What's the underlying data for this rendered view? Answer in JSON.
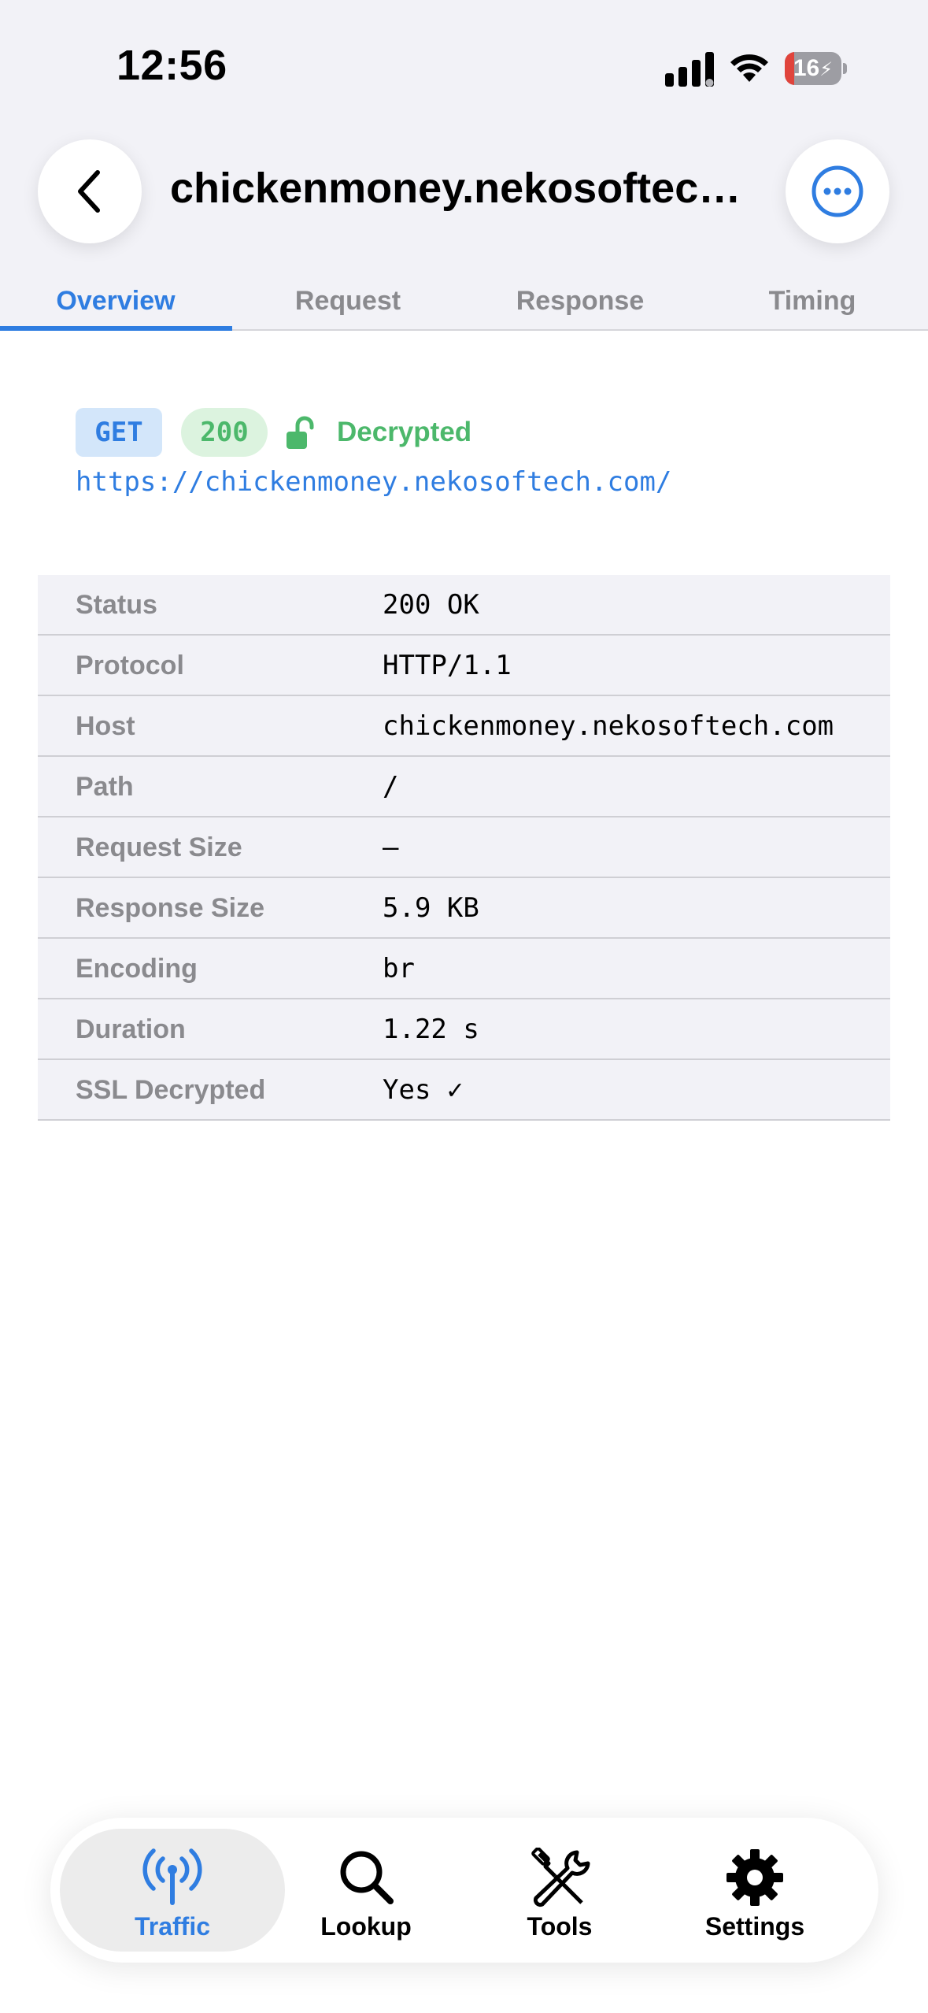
{
  "status_bar": {
    "time": "12:56",
    "battery_level": "16",
    "battery_fraction": 0.16
  },
  "nav": {
    "title": "chickenmoney.nekosoftech.com"
  },
  "tabs": [
    {
      "label": "Overview",
      "active": true
    },
    {
      "label": "Request",
      "active": false
    },
    {
      "label": "Response",
      "active": false
    },
    {
      "label": "Timing",
      "active": false
    }
  ],
  "summary": {
    "method": "GET",
    "status_code": "200",
    "decrypted_label": "Decrypted",
    "url": "https://chickenmoney.nekosoftech.com/"
  },
  "info_rows": [
    {
      "key": "Status",
      "value": "200 OK"
    },
    {
      "key": "Protocol",
      "value": "HTTP/1.1"
    },
    {
      "key": "Host",
      "value": "chickenmoney.nekosoftech.com"
    },
    {
      "key": "Path",
      "value": "/"
    },
    {
      "key": "Request Size",
      "value": "—"
    },
    {
      "key": "Response Size",
      "value": "5.9 KB"
    },
    {
      "key": "Encoding",
      "value": "br"
    },
    {
      "key": "Duration",
      "value": "1.22 s"
    },
    {
      "key": "SSL Decrypted",
      "value": "Yes ✓"
    }
  ],
  "tabbar": [
    {
      "label": "Traffic",
      "icon": "antenna-icon",
      "active": true
    },
    {
      "label": "Lookup",
      "icon": "search-icon",
      "active": false
    },
    {
      "label": "Tools",
      "icon": "tools-icon",
      "active": false
    },
    {
      "label": "Settings",
      "icon": "gear-icon",
      "active": false
    }
  ],
  "colors": {
    "accent": "#2f7de1",
    "success": "#4cb86b",
    "battery_low": "#e0443c"
  }
}
